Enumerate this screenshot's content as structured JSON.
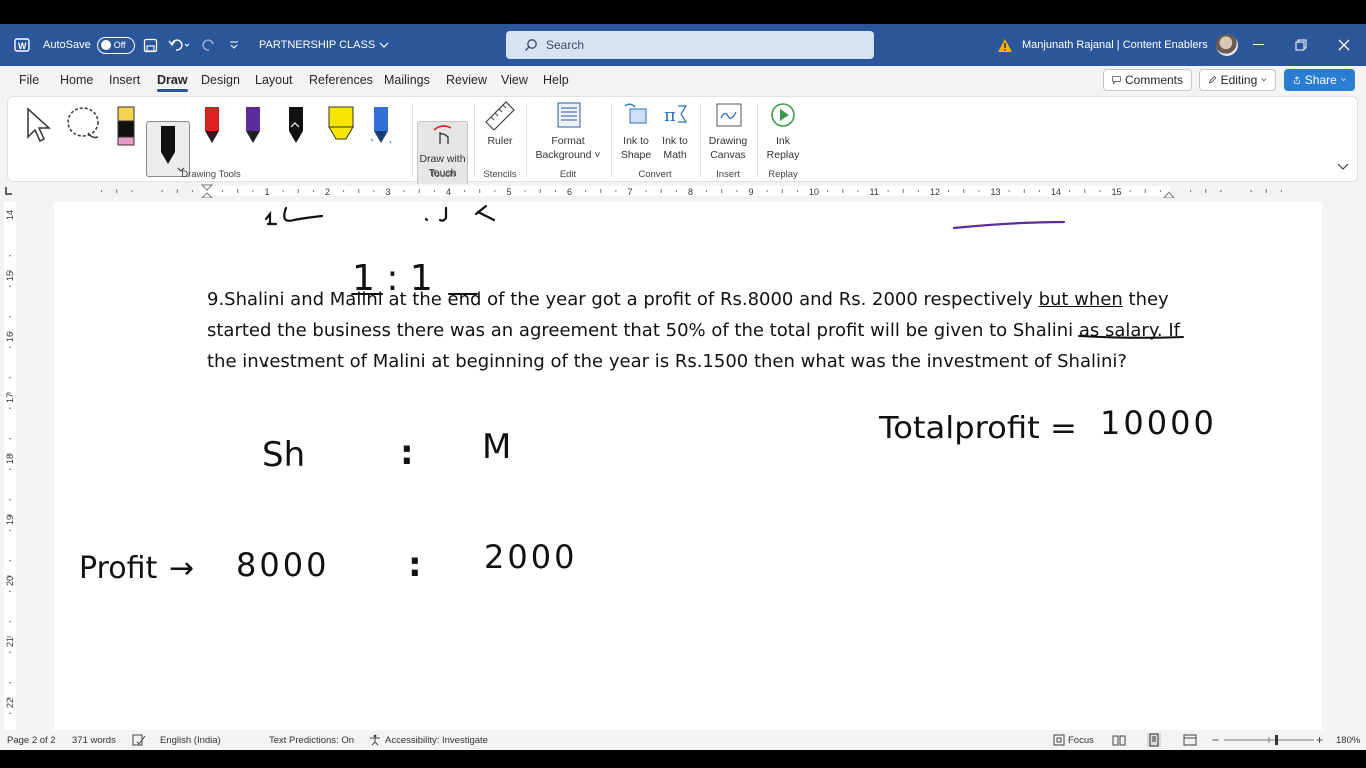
{
  "titlebar": {
    "autosave_label": "AutoSave",
    "autosave_state": "Off",
    "doc_title": "PARTNERSHIP CLASS",
    "search_placeholder": "Search",
    "user_name": "Manjunath Rajanal | Content Enablers"
  },
  "menu": {
    "tabs": [
      "File",
      "Home",
      "Insert",
      "Draw",
      "Design",
      "Layout",
      "References",
      "Mailings",
      "Review",
      "View",
      "Help"
    ],
    "active_tab": "Draw",
    "comments_label": "Comments",
    "editing_label": "Editing",
    "share_label": "Share"
  },
  "ribbon": {
    "groups": {
      "drawing_tools": "Drawing Tools",
      "touch": "Touch",
      "stencils": "Stencils",
      "edit": "Edit",
      "convert": "Convert",
      "insert": "Insert",
      "replay": "Replay"
    },
    "draw_with_touch_l1": "Draw with",
    "draw_with_touch_l2": "Touch",
    "ruler": "Ruler",
    "format_bg_l1": "Format",
    "format_bg_l2": "Background",
    "ink_to_shape_l1": "Ink to",
    "ink_to_shape_l2": "Shape",
    "ink_to_math_l1": "Ink to",
    "ink_to_math_l2": "Math",
    "drawing_canvas_l1": "Drawing",
    "drawing_canvas_l2": "Canvas",
    "ink_replay_l1": "Ink",
    "ink_replay_l2": "Replay",
    "pen_colors": [
      "#f4d44d",
      "#111111",
      "#e02020",
      "#5b2d9a",
      "#111111",
      "#f7e600",
      "#2f6fd6"
    ]
  },
  "ruler": {
    "h_numbers": [
      "1",
      "2",
      "3",
      "4",
      "5",
      "6",
      "7",
      "8",
      "9",
      "10",
      "11",
      "12",
      "13",
      "14",
      "15"
    ],
    "v_numbers": [
      "14",
      "15",
      "16",
      "17",
      "18",
      "19",
      "20",
      "21",
      "22"
    ]
  },
  "document": {
    "question_part1": "9.Shalini and Malini at the end of the year got a profit of Rs.8000 and Rs. 2000 respectively ",
    "question_underlined": "but when",
    "question_part2": " they started the business there was an agreement that 50% of the total profit will be given to Shalini as salary. If the investment of Malini at beginning of the year is Rs.1500 then what was the investment of Shalini?",
    "ink": {
      "ratio_top": "1 : 1",
      "sh": "Sh",
      "m": "M",
      "colon": ":",
      "total_profit_label": "Totalprofit =",
      "total_profit_value": "10000",
      "profit_label": "Profit",
      "profit_arrow": "→",
      "profit_sh": "8000",
      "profit_m": "2000"
    }
  },
  "statusbar": {
    "page": "Page 2 of 2",
    "words": "371 words",
    "language": "English (India)",
    "text_predictions": "Text Predictions: On",
    "accessibility": "Accessibility: Investigate",
    "focus": "Focus",
    "zoom": "180%"
  }
}
